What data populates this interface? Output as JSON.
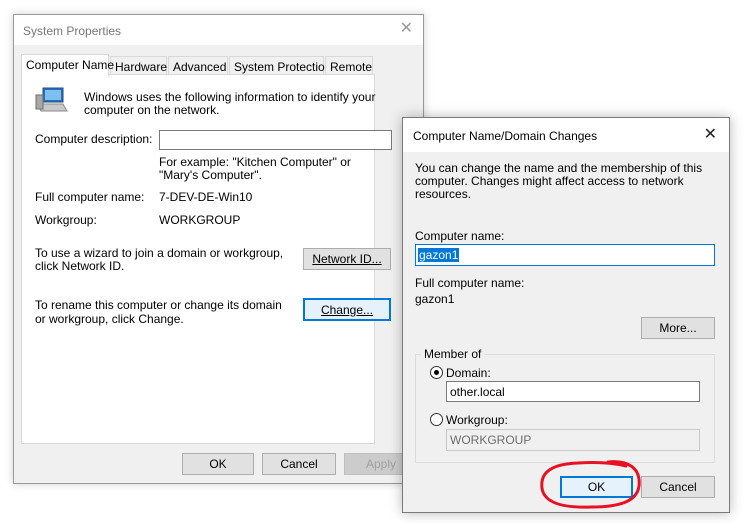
{
  "system_properties": {
    "title": "System Properties",
    "tabs": [
      "Computer Name",
      "Hardware",
      "Advanced",
      "System Protection",
      "Remote"
    ],
    "intro_text": "Windows uses the following information to identify your computer on the network.",
    "description_label": "Computer description:",
    "description_value": "",
    "example_text": "For example: \"Kitchen Computer\" or \"Mary's Computer\".",
    "full_name_label": "Full computer name:",
    "full_name_value": "7-DEV-DE-Win10",
    "workgroup_label": "Workgroup:",
    "workgroup_value": "WORKGROUP",
    "network_text": "To use a wizard to join a domain or workgroup, click Network ID.",
    "network_button": "Network ID...",
    "rename_text": "To rename this computer or change its domain or workgroup, click Change.",
    "change_button": "Change...",
    "ok_button": "OK",
    "cancel_button": "Cancel",
    "apply_button": "Apply"
  },
  "domain_dialog": {
    "title": "Computer Name/Domain Changes",
    "intro_text": "You can change the name and the membership of this computer. Changes might affect access to network resources.",
    "computer_name_label": "Computer name:",
    "computer_name_value": "gazon1",
    "full_name_label": "Full computer name:",
    "full_name_value": "gazon1",
    "more_button": "More...",
    "member_of_label": "Member of",
    "domain_label": "Domain:",
    "domain_value": "other.local",
    "domain_selected": true,
    "workgroup_label": "Workgroup:",
    "workgroup_value": "WORKGROUP",
    "ok_button": "OK",
    "cancel_button": "Cancel"
  },
  "colors": {
    "accent": "#0078d7",
    "annotation": "#e81123"
  },
  "icons": {
    "close": "close-icon",
    "computer": "computer-icon"
  }
}
